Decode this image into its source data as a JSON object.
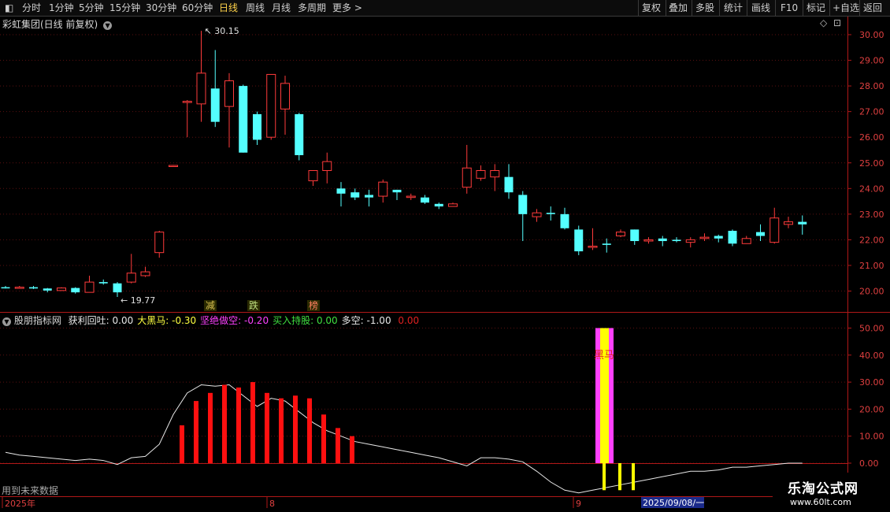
{
  "toolbar": {
    "left_items": [
      "分时",
      "1分钟",
      "5分钟",
      "15分钟",
      "30分钟",
      "60分钟",
      "日线",
      "周线",
      "月线",
      "多周期",
      "更多 >"
    ],
    "active_item": "日线",
    "right_items": [
      "复权",
      "叠加",
      "多股",
      "统计",
      "画线",
      "F10",
      "标记",
      "+自选",
      "返回"
    ]
  },
  "stock_title": "彩虹集团(日线 前复权)",
  "price_axis": {
    "labels": [
      "30.00",
      "29.00",
      "28.00",
      "27.00",
      "26.00",
      "25.00",
      "24.00",
      "23.00",
      "22.00",
      "21.00",
      "20.00"
    ],
    "values": [
      30,
      29,
      28,
      27,
      26,
      25,
      24,
      23,
      22,
      21,
      20
    ]
  },
  "annotations": {
    "high": "30.15",
    "low": "19.77"
  },
  "signal_labels": [
    "减",
    "跌",
    "榜"
  ],
  "indicator": {
    "name": "股朋指标网",
    "items": [
      {
        "label": "获利回吐:",
        "value": "0.00",
        "color": "#e8e8e8"
      },
      {
        "label": "大黑马:",
        "value": "-0.30",
        "color": "#ffff40"
      },
      {
        "label": "坚绝做空:",
        "value": "-0.20",
        "color": "#ff40ff"
      },
      {
        "label": "买入持股:",
        "value": "0.00",
        "color": "#40e040"
      },
      {
        "label": "多空:",
        "value": "-1.00",
        "color": "#e8e8e8"
      },
      {
        "label": "",
        "value": "0.00",
        "color": "#e02020"
      }
    ],
    "axis_labels": [
      "50.00",
      "40.00",
      "30.00",
      "20.00",
      "10.00",
      "0.00"
    ],
    "axis_values": [
      50,
      40,
      30,
      20,
      10,
      0
    ],
    "heima_label": "黑马"
  },
  "footer": {
    "future_data_note": "用到未来数据",
    "date_labels": [
      "2025年",
      "8",
      "9"
    ],
    "cursor_date": "2025/09/08/一"
  },
  "watermark": {
    "title": "乐淘公式网",
    "url": "www.60lt.com"
  },
  "colors": {
    "up": "#ff3b3b",
    "down": "#54ffff",
    "axis": "#b01818",
    "grid": "#5a1010",
    "bar": "#ff1010"
  },
  "chart_data": {
    "type": "candlestick",
    "ohlc": [
      [
        20.15,
        20.2,
        20.1,
        20.12
      ],
      [
        20.12,
        20.2,
        20.1,
        20.15
      ],
      [
        20.15,
        20.2,
        20.08,
        20.1
      ],
      [
        20.1,
        20.12,
        19.95,
        20.02
      ],
      [
        20.02,
        20.15,
        20.0,
        20.12
      ],
      [
        20.12,
        20.15,
        19.9,
        19.95
      ],
      [
        19.95,
        20.6,
        19.95,
        20.35
      ],
      [
        20.35,
        20.45,
        20.25,
        20.3
      ],
      [
        20.3,
        20.35,
        19.77,
        19.95
      ],
      [
        20.35,
        21.45,
        20.3,
        20.7
      ],
      [
        20.6,
        20.95,
        20.55,
        20.75
      ],
      [
        21.5,
        22.35,
        21.3,
        22.3
      ],
      [
        24.9,
        24.92,
        24.88,
        24.9
      ],
      [
        27.4,
        27.45,
        26.0,
        27.4
      ],
      [
        27.3,
        30.15,
        26.6,
        28.5
      ],
      [
        27.9,
        29.4,
        26.4,
        26.6
      ],
      [
        27.2,
        28.5,
        25.6,
        28.2
      ],
      [
        28.0,
        28.05,
        25.4,
        25.4
      ],
      [
        26.9,
        27.0,
        25.7,
        25.9
      ],
      [
        26.0,
        28.45,
        25.9,
        28.45
      ],
      [
        27.1,
        28.4,
        26.1,
        28.1
      ],
      [
        26.9,
        26.95,
        25.1,
        25.3
      ],
      [
        24.3,
        24.6,
        24.1,
        24.7
      ],
      [
        24.7,
        25.4,
        24.2,
        25.05
      ],
      [
        24.0,
        24.25,
        23.3,
        23.8
      ],
      [
        23.85,
        24.0,
        23.55,
        23.65
      ],
      [
        23.75,
        23.95,
        23.3,
        23.65
      ],
      [
        23.7,
        24.35,
        23.45,
        24.25
      ],
      [
        23.95,
        23.95,
        23.55,
        23.85
      ],
      [
        23.65,
        23.8,
        23.55,
        23.7
      ],
      [
        23.65,
        23.75,
        23.4,
        23.45
      ],
      [
        23.4,
        23.45,
        23.2,
        23.3
      ],
      [
        23.3,
        23.45,
        23.3,
        23.4
      ],
      [
        24.05,
        25.7,
        23.8,
        24.8
      ],
      [
        24.4,
        24.9,
        24.3,
        24.7
      ],
      [
        24.45,
        24.95,
        23.9,
        24.7
      ],
      [
        24.45,
        24.95,
        23.6,
        23.85
      ],
      [
        23.75,
        23.9,
        21.95,
        23.0
      ],
      [
        22.9,
        23.2,
        22.7,
        23.05
      ],
      [
        23.05,
        23.3,
        22.75,
        23.0
      ],
      [
        23.0,
        23.25,
        22.4,
        22.45
      ],
      [
        22.4,
        22.55,
        21.4,
        21.55
      ],
      [
        21.75,
        22.45,
        21.6,
        21.75
      ],
      [
        21.85,
        22.05,
        21.5,
        21.8
      ],
      [
        22.15,
        22.4,
        22.1,
        22.3
      ],
      [
        22.4,
        22.4,
        21.8,
        21.95
      ],
      [
        21.95,
        22.1,
        21.85,
        22.0
      ],
      [
        22.05,
        22.15,
        21.75,
        21.95
      ],
      [
        22.0,
        22.1,
        21.9,
        21.95
      ],
      [
        21.9,
        22.1,
        21.7,
        22.0
      ],
      [
        22.05,
        22.25,
        21.95,
        22.1
      ],
      [
        22.15,
        22.2,
        21.9,
        22.05
      ],
      [
        22.35,
        22.4,
        21.75,
        21.85
      ],
      [
        21.85,
        22.15,
        21.85,
        22.05
      ],
      [
        22.3,
        22.6,
        21.95,
        22.15
      ],
      [
        21.9,
        23.25,
        21.85,
        22.85
      ],
      [
        22.6,
        22.9,
        22.45,
        22.7
      ],
      [
        22.7,
        22.95,
        22.2,
        22.6
      ]
    ],
    "profit_bars": [
      14,
      23,
      26,
      29,
      28,
      30,
      26,
      24,
      25,
      24,
      18,
      13,
      10
    ],
    "heima_value": 50,
    "price_range": [
      19.5,
      30.5
    ],
    "indicator_range": [
      -10,
      53
    ]
  }
}
